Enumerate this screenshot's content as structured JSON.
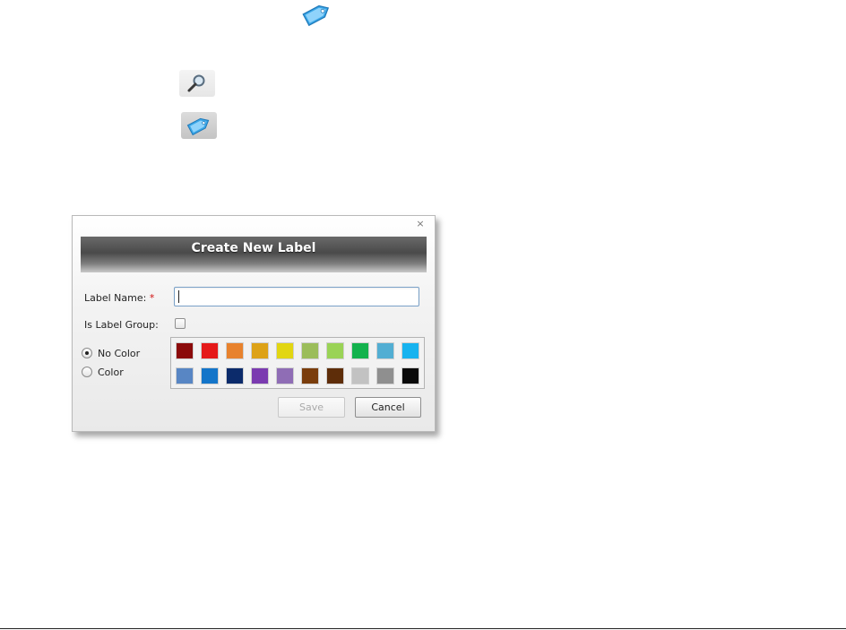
{
  "dialog": {
    "title": "Create New Label",
    "close_glyph": "×",
    "label_name": {
      "label": "Label Name:",
      "required_mark": "*",
      "value": ""
    },
    "is_label_group": {
      "label": "Is Label Group:",
      "checked": false
    },
    "color_options": [
      {
        "label": "No Color",
        "selected": true
      },
      {
        "label": "Color",
        "selected": false
      }
    ],
    "palette": {
      "row1": [
        "#8b0a0a",
        "#e51919",
        "#e8822d",
        "#dda217",
        "#e2d611",
        "#9bbd5a",
        "#9ad356",
        "#13b24d",
        "#52aed3",
        "#17b3ef"
      ],
      "row2": [
        "#5886c4",
        "#1475c9",
        "#0c2b6b",
        "#7b3bb0",
        "#8f6db5",
        "#7a3d0c",
        "#5e2d09",
        "#c2c2c2",
        "#8f8f8f",
        "#0a0a0a"
      ]
    },
    "save_label": "Save",
    "cancel_label": "Cancel"
  },
  "icons": {
    "top_tag": "tag-icon",
    "search": "magnifier-icon",
    "tag": "tag-icon"
  },
  "colors": {
    "tag_blue": "#3aa7e8",
    "input_border": "#7aa1c8"
  }
}
